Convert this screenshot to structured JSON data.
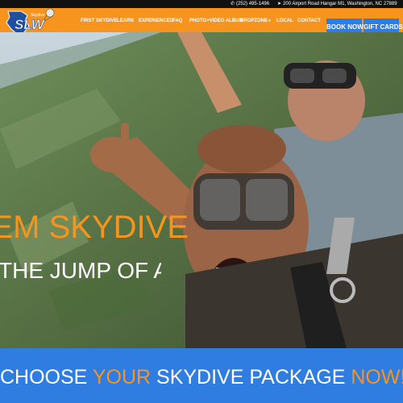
{
  "topbar": {
    "phone": "(252) 495-1496",
    "address": "200 Airport Road Hangar M1, Washington, NC 27889"
  },
  "logo": {
    "text": "SLW",
    "small": "Skydive"
  },
  "nav": {
    "items": [
      {
        "label": "FIRST SKYDIVE",
        "dropdown": false
      },
      {
        "label": "LEARN",
        "dropdown": false
      },
      {
        "label": "EXPERIENCED",
        "dropdown": false
      },
      {
        "label": "FAQ",
        "dropdown": false
      },
      {
        "label": "PHOTO+VIDEO ALBUM",
        "dropdown": false
      },
      {
        "label": "DROPZONE",
        "dropdown": true
      },
      {
        "label": "LOCAL",
        "dropdown": false
      },
      {
        "label": "CONTACT",
        "dropdown": false
      }
    ],
    "book_now": "BOOK NOW",
    "gift_cards": "GIFT CARDS"
  },
  "hero": {
    "headline": "TANDEM SKYDIVE",
    "subline": "THE JUMP OF A LIFETIME"
  },
  "cta": {
    "part1": "CHOOSE ",
    "highlight1": "YOUR",
    "part2": " SKYDIVE PACKAGE ",
    "highlight2": "NOW!"
  },
  "colors": {
    "accent": "#f7941d",
    "blue": "#2f7de1",
    "topbar": "#111111"
  }
}
